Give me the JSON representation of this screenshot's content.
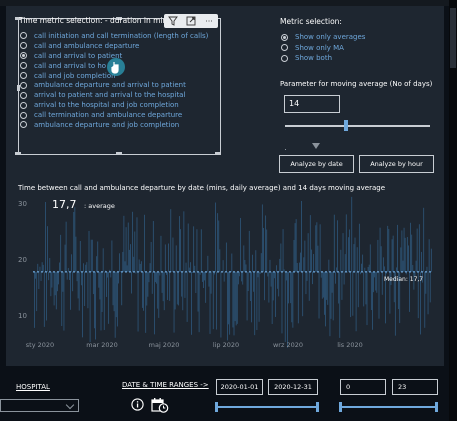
{
  "slicer": {
    "title": "Time metric selection: - duration in mins",
    "items": [
      {
        "label": "call initiation and call termination (length of calls)",
        "selected": false
      },
      {
        "label": "call and ambulance departure",
        "selected": false
      },
      {
        "label": "call and arrival to patient",
        "selected": true
      },
      {
        "label": "call and arrival to ho",
        "selected": false
      },
      {
        "label": "call and job completion",
        "selected": false
      },
      {
        "label": "ambulance departure and arrival to patient",
        "selected": false
      },
      {
        "label": "arrival to patient and arrival to the hospital",
        "selected": false
      },
      {
        "label": "arrival to the hospital and job completion",
        "selected": false
      },
      {
        "label": "call termination and ambulance departure",
        "selected": false
      },
      {
        "label": "ambulance departure and job completion",
        "selected": false
      }
    ],
    "tool_icons": [
      "filter-icon",
      "focus-mode-icon",
      "more-options-icon"
    ],
    "more_label": "···"
  },
  "metric": {
    "title": "Metric selection:",
    "options": [
      {
        "label": "Show only averages",
        "selected": true
      },
      {
        "label": "Show only MA",
        "selected": false
      },
      {
        "label": "Show both",
        "selected": false
      }
    ]
  },
  "moving_average": {
    "title": "Parameter for moving average (No of days)",
    "value": "14"
  },
  "buttons": {
    "by_date": "Analyze by date",
    "by_hour": "Analyze by hour"
  },
  "chart_data": {
    "type": "bar",
    "title": "Time between call and ambulance departure by date (mins, daily average) and 14 days moving average",
    "average_value": "17,7",
    "average_label": ": average",
    "median_label": "Median: 17,7",
    "median": 17.7,
    "ylim": [
      5,
      30
    ],
    "y_ticks": [
      "30",
      "20",
      "10"
    ],
    "x_ticks": [
      "sty 2020",
      "mar 2020",
      "maj 2020",
      "lip 2020",
      "wrz 2020",
      "lis 2020"
    ],
    "xlabel": "",
    "ylabel": "",
    "grid": false,
    "colors": {
      "bars": "#2e5679",
      "median_line": "#6fa8dc"
    }
  },
  "filters": {
    "hospital_label": "HOSPITAL",
    "range_label": "DATE & TIME RANGES ->",
    "date_from": "2020-01-01",
    "date_to": "2020-12-31",
    "hour_from": "0",
    "hour_to": "23"
  },
  "colors": {
    "background": "#0b1017",
    "panel": "#1e2630",
    "accent": "#6fa8dc",
    "text": "#ffffff",
    "muted": "#8b939c"
  }
}
